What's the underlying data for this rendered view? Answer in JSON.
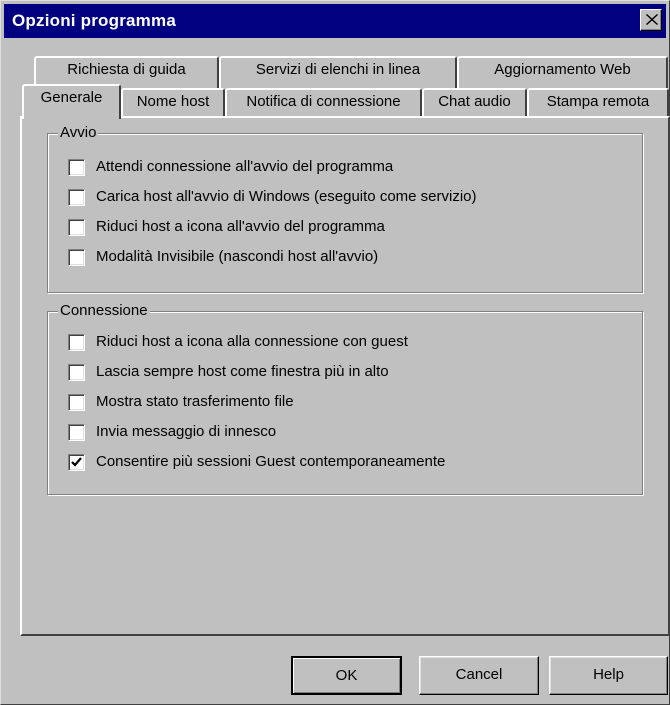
{
  "window": {
    "title": "Opzioni programma"
  },
  "tabs": {
    "back_row": [
      "Richiesta di guida",
      "Servizi di elenchi in linea",
      "Aggiornamento Web"
    ],
    "front_row": [
      "Generale",
      "Nome host",
      "Notifica di connessione",
      "Chat audio",
      "Stampa remota"
    ],
    "active": "Generale"
  },
  "groups": {
    "avvio": {
      "label": "Avvio",
      "options": [
        {
          "label": "Attendi connessione all'avvio del programma",
          "checked": false
        },
        {
          "label": "Carica host all'avvio di Windows (eseguito come servizio)",
          "checked": false
        },
        {
          "label": "Riduci host a icona all'avvio del programma",
          "checked": false
        },
        {
          "label": "Modalità Invisibile (nascondi host all'avvio)",
          "checked": false
        }
      ]
    },
    "connessione": {
      "label": "Connessione",
      "options": [
        {
          "label": "Riduci host a icona alla connessione con guest",
          "checked": false
        },
        {
          "label": "Lascia sempre host come finestra più in alto",
          "checked": false
        },
        {
          "label": "Mostra stato trasferimento file",
          "checked": false
        },
        {
          "label": "Invia messaggio di innesco",
          "checked": false
        },
        {
          "label": "Consentire più sessioni Guest contemporaneamente",
          "checked": true
        }
      ]
    }
  },
  "buttons": {
    "ok": "OK",
    "cancel": "Cancel",
    "help": "Help"
  },
  "icons": {
    "close": "close-icon",
    "check": "checkmark-icon"
  },
  "colors": {
    "titlebar": "#000080",
    "face": "#c0c0c0"
  }
}
